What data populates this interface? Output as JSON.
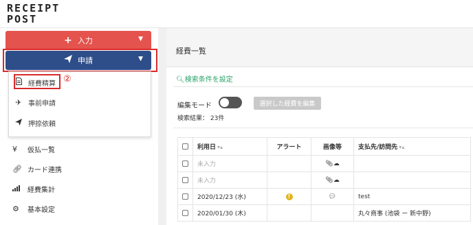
{
  "app": {
    "logo_line1": "RECEIPT",
    "logo_line2": "POST"
  },
  "sidebar": {
    "input_button": {
      "icon": "plus-icon",
      "label": "入力"
    },
    "apply_button": {
      "icon": "paper-plane-icon",
      "label": "申請"
    },
    "annotation_1": "①",
    "annotation_2": "②",
    "dropdown_items": [
      {
        "icon": "document-icon",
        "label": "経費精算"
      },
      {
        "icon": "airplane-icon",
        "label": "事前申請"
      },
      {
        "icon": "paper-plane-icon",
        "label": "押捺依頼"
      }
    ],
    "nav_items": [
      {
        "icon": "yen-icon",
        "label": "仮払一覧"
      },
      {
        "icon": "link-icon",
        "label": "カード連携"
      },
      {
        "icon": "signal-bars-icon",
        "label": "経費集計"
      },
      {
        "icon": "gear-icon",
        "label": "基本設定"
      }
    ]
  },
  "main": {
    "title": "経費一覧",
    "search_settings_link": "検索条件を設定",
    "edit_mode_label": "編集モード",
    "edit_selected_button": "選択した経費を編集",
    "result_count": "検索結果： 23件",
    "table": {
      "headers": {
        "date": "利用日",
        "alert": "アラート",
        "image": "画像等",
        "payee": "支払先/訪問先"
      },
      "rows": [
        {
          "date": "未入力",
          "alert": "",
          "image": "attachment-icon",
          "payee": ""
        },
        {
          "date": "未入力",
          "alert": "",
          "image": "attachment-icon",
          "payee": ""
        },
        {
          "date": "2020/12/23 (水)",
          "alert": "!",
          "image": "comment-icon",
          "payee": "test"
        },
        {
          "date": "2020/01/30 (木)",
          "alert": "",
          "image": "",
          "payee": "丸々商事 (池袋 ー 新中野)"
        }
      ]
    }
  }
}
